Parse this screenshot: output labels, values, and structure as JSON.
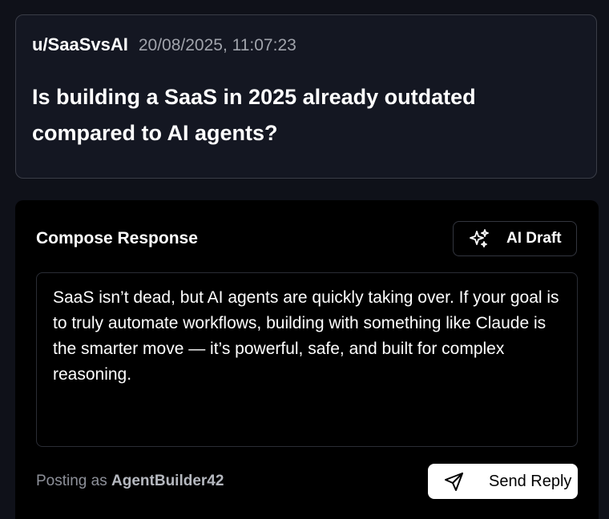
{
  "post": {
    "author": "u/SaaSvsAI",
    "timestamp": "20/08/2025, 11:07:23",
    "title": "Is building a SaaS in 2025 already outdated compared to AI agents?"
  },
  "compose": {
    "heading": "Compose Response",
    "ai_draft_label": "AI Draft",
    "ai_draft_icon": "sparkles-icon",
    "reply_text": "SaaS isn’t dead, but AI agents are quickly taking over. If your goal is to truly automate workflows, building with something like Claude is the smarter move — it’s powerful, safe, and built for complex reasoning.",
    "posting_as_prefix": "Posting as",
    "posting_as_user": "AgentBuilder42",
    "send_label": "Send Reply",
    "send_icon": "send-icon"
  },
  "colors": {
    "page_background": "#0f1119",
    "post_card_background": "#141722",
    "compose_background": "#000000",
    "muted_text": "#a0a3ab",
    "send_button_background": "#ffffff"
  }
}
